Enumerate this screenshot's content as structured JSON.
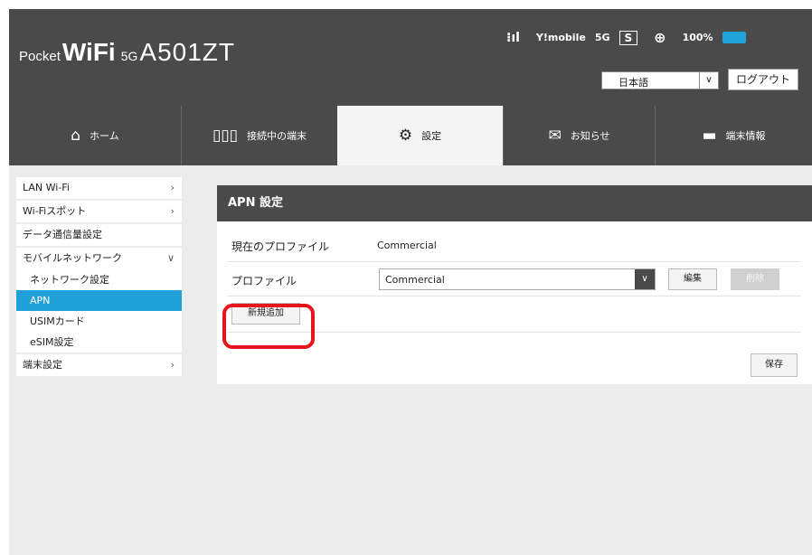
{
  "header": {
    "brand_pocket": "Pocket",
    "brand_wifi": "WiFi",
    "brand_5g": "5G",
    "brand_model": "A501ZT",
    "signal_icon": "signal-icon",
    "carrier": "Y!mobile",
    "network": "5G",
    "sim_badge": "S",
    "battery": "100%",
    "battery_color": "#1fa3d8",
    "language": {
      "value": "日本語",
      "options": [
        "日本語"
      ]
    },
    "logout_label": "ログアウト"
  },
  "nav": {
    "tabs": [
      {
        "label": "ホーム",
        "icon": "home-icon"
      },
      {
        "label": "接続中の端末",
        "icon": "devices-icon"
      },
      {
        "label": "設定",
        "icon": "gear-icon",
        "active": true
      },
      {
        "label": "お知らせ",
        "icon": "mail-icon"
      },
      {
        "label": "端末情報",
        "icon": "device-info-icon"
      }
    ]
  },
  "sidebar": {
    "items": [
      {
        "label": "LAN Wi-Fi"
      },
      {
        "label": "Wi-Fiスポット"
      },
      {
        "label": "データ通信量設定"
      },
      {
        "label": "モバイルネットワーク"
      },
      {
        "label": "端末設定"
      }
    ],
    "mobile_sub": [
      {
        "label": "ネットワーク設定"
      },
      {
        "label": "APN",
        "active": true
      },
      {
        "label": "USIMカード"
      },
      {
        "label": "eSIM設定"
      }
    ]
  },
  "main": {
    "title": "APN 設定",
    "current_profile_label": "現在のプロファイル",
    "current_profile_value": "Commercial",
    "profile_label": "プロファイル",
    "profile_value": "Commercial",
    "edit_label": "編集",
    "delete_label": "削除",
    "add_label": "新規追加",
    "save_label": "保存"
  },
  "colors": {
    "accent": "#1fa0d6",
    "header": "#4a4a4a",
    "highlight": "#e8141c"
  }
}
